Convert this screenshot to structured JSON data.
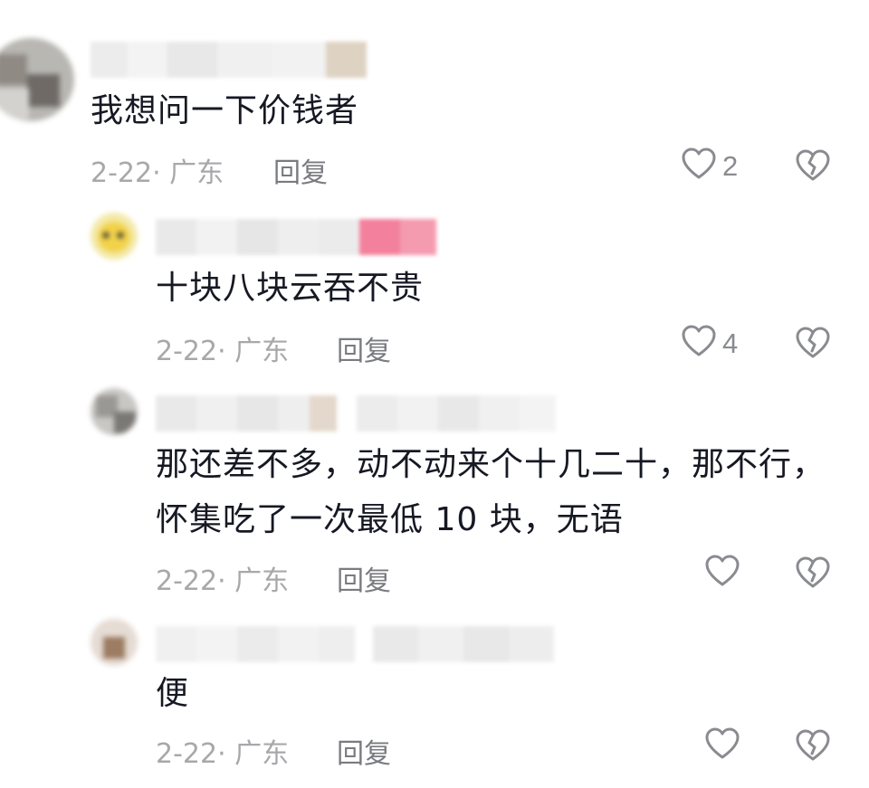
{
  "comments": [
    {
      "text_lines": [
        "我想问一下价钱者"
      ],
      "date": "2-22",
      "location": "· 广东",
      "reply_label": "回复",
      "likes": "2",
      "like_icon": "heart-outline-icon",
      "dislike_icon": "broken-heart-icon"
    },
    {
      "text_lines": [
        "十块八块云吞不贵"
      ],
      "date": "2-22",
      "location": "· 广东",
      "reply_label": "回复",
      "likes": "4",
      "like_icon": "heart-outline-icon",
      "dislike_icon": "broken-heart-icon"
    },
    {
      "text_lines": [
        "那还差不多，动不动来个十几二十，那不行，",
        "怀集吃了一次最低 10 块，无语"
      ],
      "date": "2-22",
      "location": "· 广东",
      "reply_label": "回复",
      "likes": "",
      "like_icon": "heart-outline-icon",
      "dislike_icon": "broken-heart-icon"
    },
    {
      "text_lines": [
        "便"
      ],
      "date": "2-22",
      "location": "· 广东",
      "reply_label": "回复",
      "likes": "",
      "like_icon": "heart-outline-icon",
      "dislike_icon": "broken-heart-icon"
    }
  ],
  "colors": {
    "text": "#161823",
    "meta": "#a8a8ab",
    "reply": "#7a7b80",
    "icon": "#8a8b90"
  }
}
